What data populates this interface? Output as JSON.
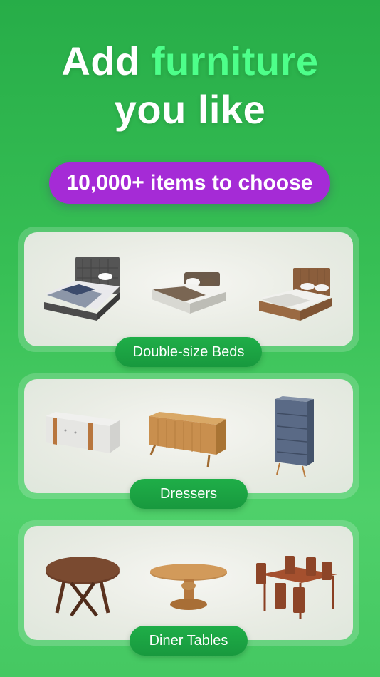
{
  "headline": {
    "line1_white": "Add",
    "line1_accent": "furniture",
    "line2": "you like"
  },
  "pill": {
    "text": "10,000+ items to choose"
  },
  "categories": [
    {
      "label": "Double-size Beds"
    },
    {
      "label": "Dressers"
    },
    {
      "label": "Diner Tables"
    }
  ],
  "colors": {
    "accent_green": "#4dff8a",
    "pill_purple": "#a52bd6",
    "label_green": "#1fae48"
  }
}
